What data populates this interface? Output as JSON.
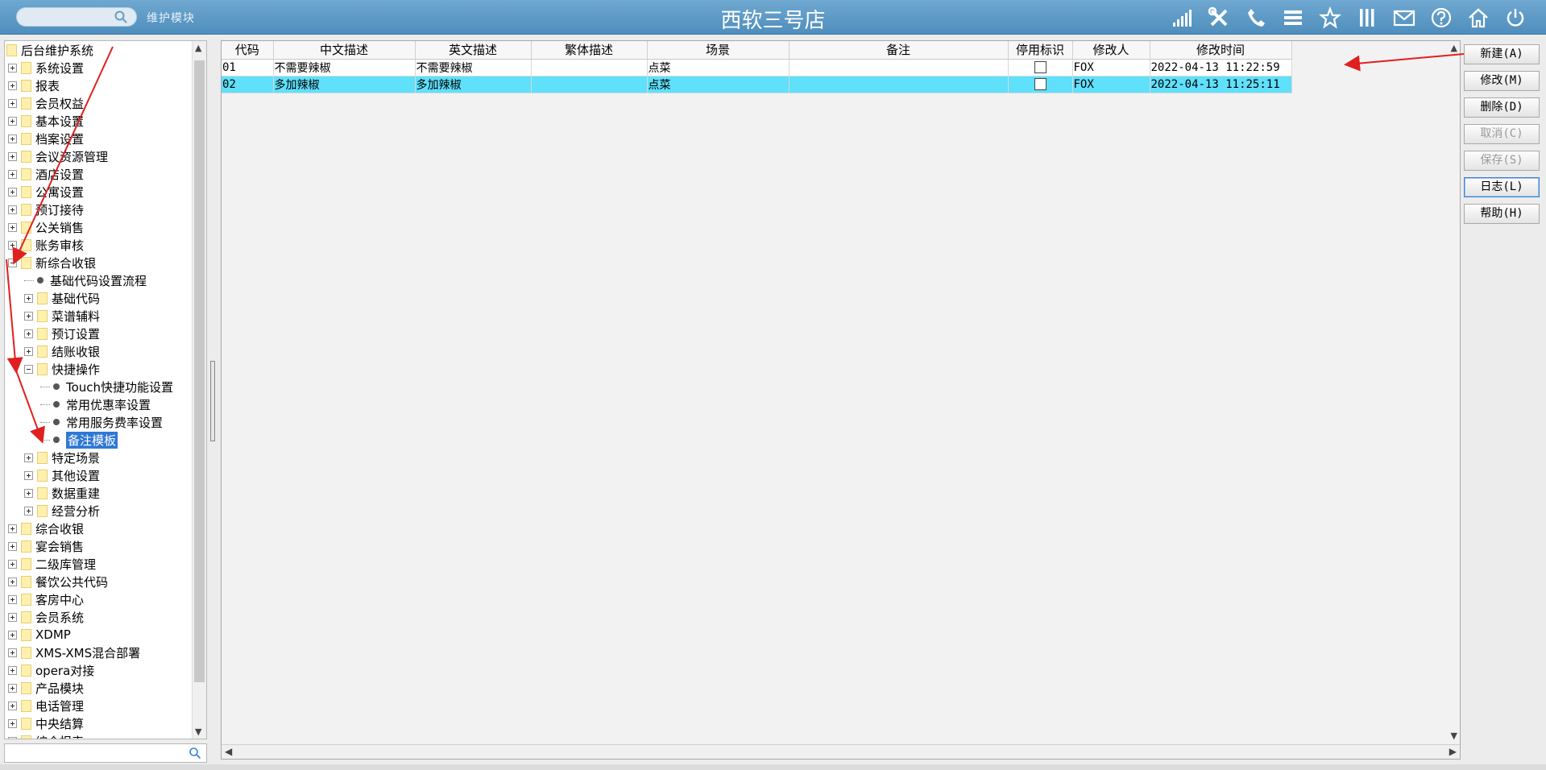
{
  "header": {
    "module_label": "维护模块",
    "title": "西软三号店",
    "icons": [
      "signal-icon",
      "tools-icon",
      "phone-icon",
      "menu-icon",
      "star-icon",
      "columns-icon",
      "mail-icon",
      "help-icon",
      "home-icon",
      "power-icon"
    ]
  },
  "tree": {
    "items": [
      {
        "label": "后台维护系统",
        "level": 0,
        "type": "root"
      },
      {
        "label": "系统设置",
        "level": 1,
        "type": "folder",
        "expanded": false
      },
      {
        "label": "报表",
        "level": 1,
        "type": "folder",
        "expanded": false
      },
      {
        "label": "会员权益",
        "level": 1,
        "type": "folder",
        "expanded": false
      },
      {
        "label": "基本设置",
        "level": 1,
        "type": "folder",
        "expanded": false
      },
      {
        "label": "档案设置",
        "level": 1,
        "type": "folder",
        "expanded": false
      },
      {
        "label": "会议资源管理",
        "level": 1,
        "type": "folder",
        "expanded": false
      },
      {
        "label": "酒店设置",
        "level": 1,
        "type": "folder",
        "expanded": false
      },
      {
        "label": "公寓设置",
        "level": 1,
        "type": "folder",
        "expanded": false
      },
      {
        "label": "预订接待",
        "level": 1,
        "type": "folder",
        "expanded": false
      },
      {
        "label": "公关销售",
        "level": 1,
        "type": "folder",
        "expanded": false
      },
      {
        "label": "账务审核",
        "level": 1,
        "type": "folder",
        "expanded": false
      },
      {
        "label": "新综合收银",
        "level": 1,
        "type": "folder",
        "expanded": true
      },
      {
        "label": "基础代码设置流程",
        "level": 2,
        "type": "leaf"
      },
      {
        "label": "基础代码",
        "level": 2,
        "type": "folder",
        "expanded": false
      },
      {
        "label": "菜谱辅料",
        "level": 2,
        "type": "folder",
        "expanded": false
      },
      {
        "label": "预订设置",
        "level": 2,
        "type": "folder",
        "expanded": false
      },
      {
        "label": "结账收银",
        "level": 2,
        "type": "folder",
        "expanded": false
      },
      {
        "label": "快捷操作",
        "level": 2,
        "type": "folder",
        "expanded": true
      },
      {
        "label": "Touch快捷功能设置",
        "level": 3,
        "type": "leaf"
      },
      {
        "label": "常用优惠率设置",
        "level": 3,
        "type": "leaf"
      },
      {
        "label": "常用服务费率设置",
        "level": 3,
        "type": "leaf"
      },
      {
        "label": "备注模板",
        "level": 3,
        "type": "leaf",
        "selected": true
      },
      {
        "label": "特定场景",
        "level": 2,
        "type": "folder",
        "expanded": false
      },
      {
        "label": "其他设置",
        "level": 2,
        "type": "folder",
        "expanded": false
      },
      {
        "label": "数据重建",
        "level": 2,
        "type": "folder",
        "expanded": false
      },
      {
        "label": "经营分析",
        "level": 2,
        "type": "folder",
        "expanded": false
      },
      {
        "label": "综合收银",
        "level": 1,
        "type": "folder",
        "expanded": false
      },
      {
        "label": "宴会销售",
        "level": 1,
        "type": "folder",
        "expanded": false
      },
      {
        "label": "二级库管理",
        "level": 1,
        "type": "folder",
        "expanded": false
      },
      {
        "label": "餐饮公共代码",
        "level": 1,
        "type": "folder",
        "expanded": false
      },
      {
        "label": "客房中心",
        "level": 1,
        "type": "folder",
        "expanded": false
      },
      {
        "label": "会员系统",
        "level": 1,
        "type": "folder",
        "expanded": false
      },
      {
        "label": "XDMP",
        "level": 1,
        "type": "folder",
        "expanded": false
      },
      {
        "label": "XMS-XMS混合部署",
        "level": 1,
        "type": "folder",
        "expanded": false
      },
      {
        "label": "opera对接",
        "level": 1,
        "type": "folder",
        "expanded": false
      },
      {
        "label": "产品模块",
        "level": 1,
        "type": "folder",
        "expanded": false
      },
      {
        "label": "电话管理",
        "level": 1,
        "type": "folder",
        "expanded": false
      },
      {
        "label": "中央结算",
        "level": 1,
        "type": "folder",
        "expanded": false
      },
      {
        "label": "综合报表",
        "level": 1,
        "type": "folder",
        "expanded": false
      }
    ],
    "search_placeholder": ""
  },
  "grid": {
    "columns": [
      "代码",
      "中文描述",
      "英文描述",
      "繁体描述",
      "场景",
      "备注",
      "停用标识",
      "修改人",
      "修改时间"
    ],
    "rows": [
      {
        "code": "01",
        "cn": "不需要辣椒",
        "en": "不需要辣椒",
        "tw": "",
        "scene": "点菜",
        "remark": "",
        "disabled": false,
        "modifier": "FOX",
        "time": "2022-04-13 11:22:59"
      },
      {
        "code": "02",
        "cn": "多加辣椒",
        "en": "多加辣椒",
        "tw": "",
        "scene": "点菜",
        "remark": "",
        "disabled": false,
        "modifier": "FOX",
        "time": "2022-04-13 11:25:11",
        "selected": true
      }
    ]
  },
  "actions": [
    {
      "label": "新建(A)",
      "enabled": true
    },
    {
      "label": "修改(M)",
      "enabled": true
    },
    {
      "label": "删除(D)",
      "enabled": true
    },
    {
      "label": "取消(C)",
      "enabled": false
    },
    {
      "label": "保存(S)",
      "enabled": false
    },
    {
      "label": "日志(L)",
      "enabled": true,
      "focused": true
    },
    {
      "label": "帮助(H)",
      "enabled": true
    }
  ],
  "colors": {
    "header": "#5b9bc8",
    "selected_row": "#5fe0fb",
    "tree_selection": "#2f78d6",
    "annotation_arrow": "#e02020"
  }
}
